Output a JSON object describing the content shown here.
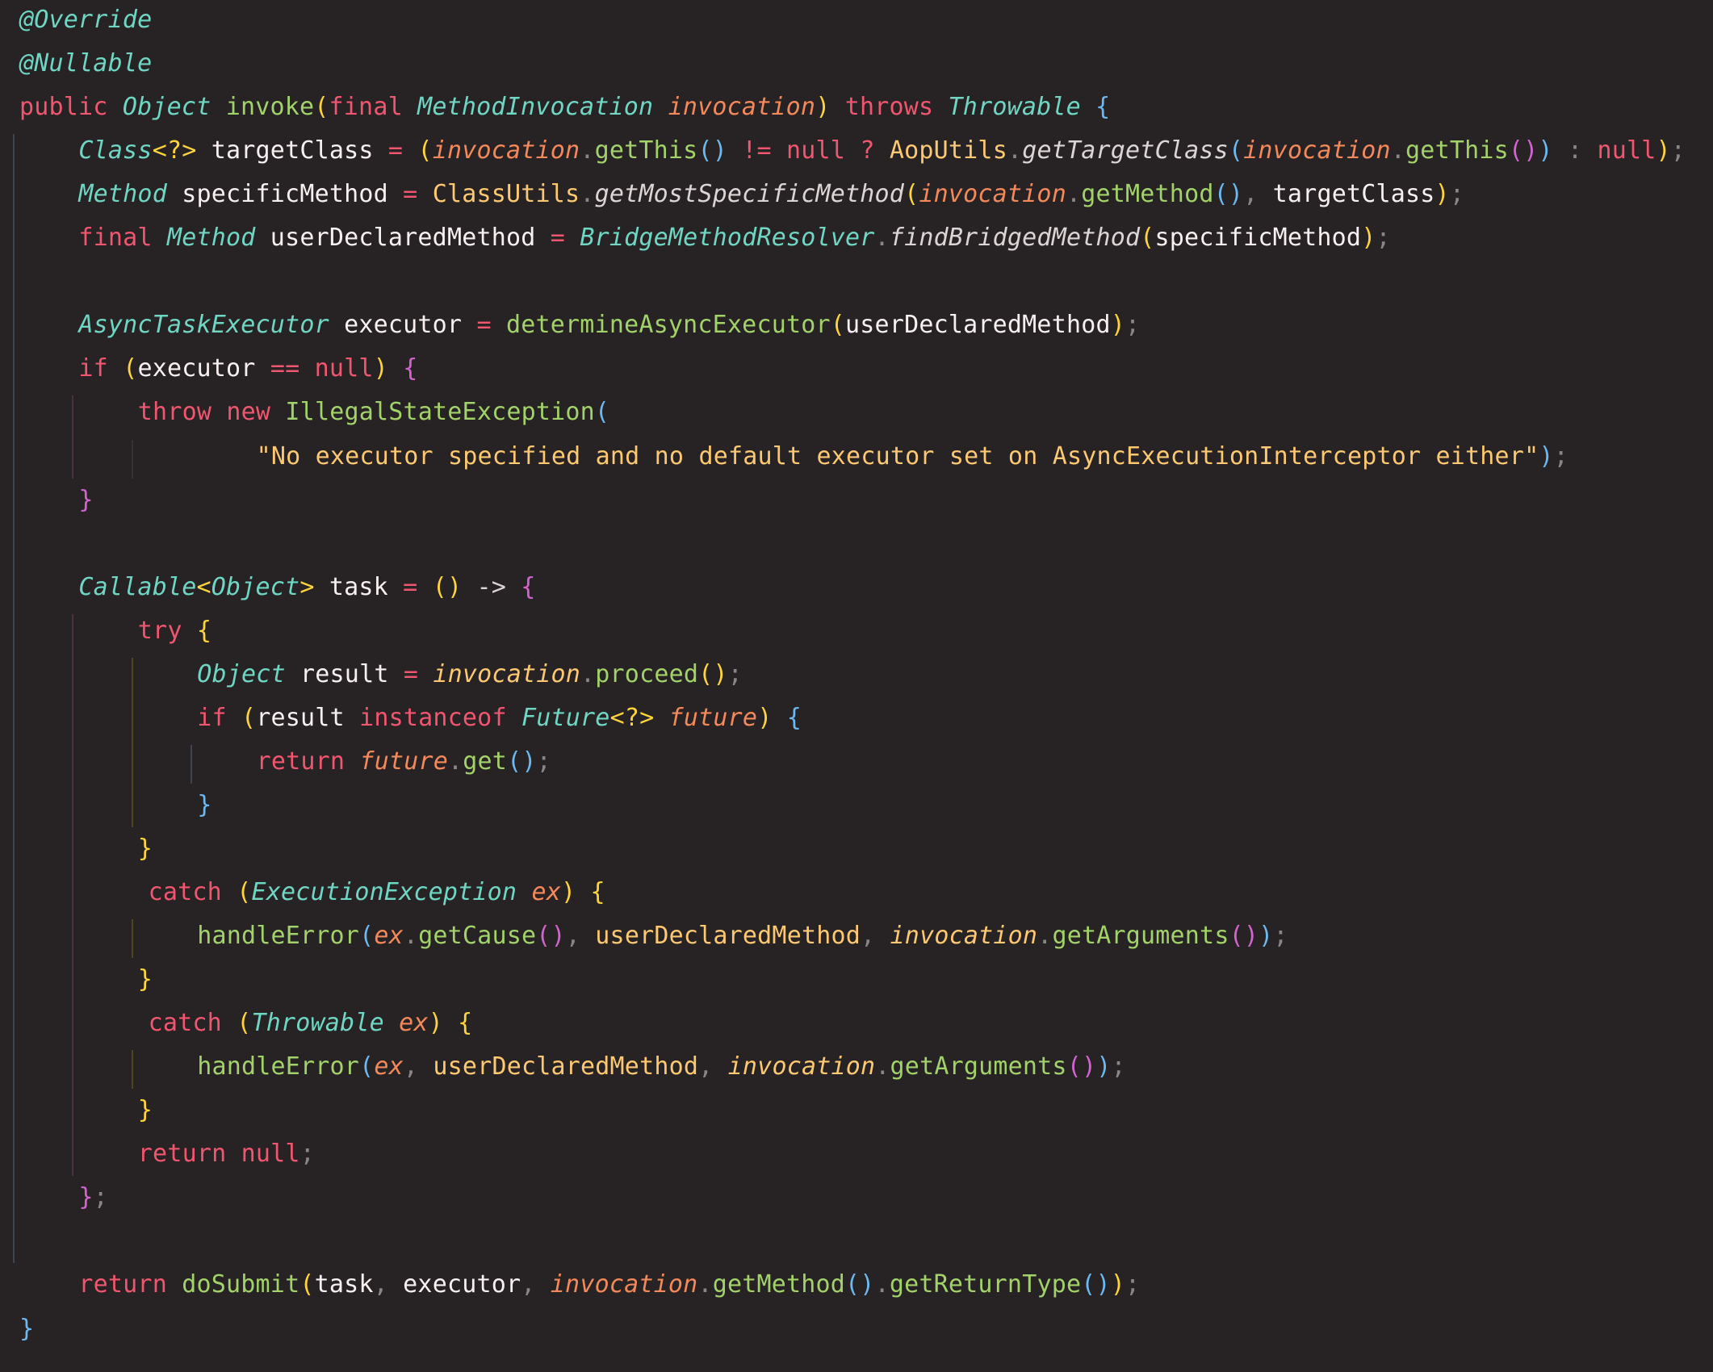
{
  "colors": {
    "background": "#272223",
    "keyword": "#f0566f",
    "type": "#6fd6c4",
    "function": "#a2d26a",
    "identifier": "#f8f0f0",
    "param": "#f3895b",
    "string": "#fcc872",
    "class_static": "#fcc872",
    "static_method": "#ddd5d5",
    "punct": "#8a8586",
    "brace_yellow": "#fdd43c",
    "brace_blue": "#6cb8f0",
    "brace_magenta": "#d264d0",
    "local_italic": "#fcc872"
  },
  "guides": [
    {
      "col": 0,
      "from_line": 3,
      "to_line": 28,
      "color": "#3e4450"
    },
    {
      "col": 1,
      "from_line": 9,
      "to_line": 10,
      "color": "#4a3040"
    },
    {
      "col": 2,
      "from_line": 10,
      "to_line": 10,
      "color": "#333"
    },
    {
      "col": 1,
      "from_line": 14,
      "to_line": 26,
      "color": "#4a3040"
    },
    {
      "col": 2,
      "from_line": 15,
      "to_line": 18,
      "color": "#504520"
    },
    {
      "col": 3,
      "from_line": 17,
      "to_line": 17,
      "color": "#3e4450"
    },
    {
      "col": 2,
      "from_line": 21,
      "to_line": 21,
      "color": "#504520"
    },
    {
      "col": 2,
      "from_line": 24,
      "to_line": 24,
      "color": "#504520"
    }
  ],
  "code": [
    {
      "indent": 0,
      "tokens": [
        [
          "@Override",
          "type",
          1
        ]
      ]
    },
    {
      "indent": 0,
      "tokens": [
        [
          "@Nullable",
          "type",
          1
        ]
      ]
    },
    {
      "indent": 0,
      "tokens": [
        [
          "public ",
          "keyword"
        ],
        [
          "Object",
          "type",
          1
        ],
        [
          " ",
          "identifier"
        ],
        [
          "invoke",
          "function"
        ],
        [
          "(",
          "brace_yellow"
        ],
        [
          "final ",
          "keyword"
        ],
        [
          "MethodInvocation",
          "type",
          1
        ],
        [
          " ",
          "identifier"
        ],
        [
          "invocation",
          "param",
          1
        ],
        [
          ")",
          "brace_yellow"
        ],
        [
          " throws ",
          "keyword"
        ],
        [
          "Throwable",
          "type",
          1
        ],
        [
          " ",
          "identifier"
        ],
        [
          "{",
          "brace_blue"
        ]
      ]
    },
    {
      "indent": 1,
      "tokens": [
        [
          "Class",
          "type",
          1
        ],
        [
          "<?>",
          "brace_yellow"
        ],
        [
          " targetClass ",
          "identifier"
        ],
        [
          "= ",
          "keyword"
        ],
        [
          "(",
          "brace_yellow"
        ],
        [
          "invocation",
          "param",
          1
        ],
        [
          ".",
          "punct"
        ],
        [
          "getThis",
          "function"
        ],
        [
          "()",
          "brace_blue"
        ],
        [
          " != null ? ",
          "keyword"
        ],
        [
          "AopUtils",
          "class_static"
        ],
        [
          ".",
          "punct"
        ],
        [
          "getTargetClass",
          "static_method",
          1
        ],
        [
          "(",
          "brace_blue"
        ],
        [
          "invocation",
          "param",
          1
        ],
        [
          ".",
          "punct"
        ],
        [
          "getThis",
          "function"
        ],
        [
          "()",
          "brace_magenta"
        ],
        [
          ")",
          "brace_blue"
        ],
        [
          " : ",
          "punct"
        ],
        [
          "null",
          "keyword"
        ],
        [
          ")",
          "brace_yellow"
        ],
        [
          ";",
          "punct"
        ]
      ]
    },
    {
      "indent": 1,
      "tokens": [
        [
          "Method",
          "type",
          1
        ],
        [
          " specificMethod ",
          "identifier"
        ],
        [
          "= ",
          "keyword"
        ],
        [
          "ClassUtils",
          "class_static"
        ],
        [
          ".",
          "punct"
        ],
        [
          "getMostSpecificMethod",
          "static_method",
          1
        ],
        [
          "(",
          "brace_yellow"
        ],
        [
          "invocation",
          "param",
          1
        ],
        [
          ".",
          "punct"
        ],
        [
          "getMethod",
          "function"
        ],
        [
          "()",
          "brace_blue"
        ],
        [
          ", ",
          "punct"
        ],
        [
          "targetClass",
          "identifier"
        ],
        [
          ")",
          "brace_yellow"
        ],
        [
          ";",
          "punct"
        ]
      ]
    },
    {
      "indent": 1,
      "tokens": [
        [
          "final ",
          "keyword"
        ],
        [
          "Method",
          "type",
          1
        ],
        [
          " userDeclaredMethod ",
          "identifier"
        ],
        [
          "= ",
          "keyword"
        ],
        [
          "BridgeMethodResolver",
          "type",
          1
        ],
        [
          ".",
          "punct"
        ],
        [
          "findBridgedMethod",
          "static_method",
          1
        ],
        [
          "(",
          "brace_yellow"
        ],
        [
          "specificMethod",
          "identifier"
        ],
        [
          ")",
          "brace_yellow"
        ],
        [
          ";",
          "punct"
        ]
      ]
    },
    {
      "indent": 0,
      "tokens": []
    },
    {
      "indent": 1,
      "tokens": [
        [
          "AsyncTaskExecutor",
          "type",
          1
        ],
        [
          " executor ",
          "identifier"
        ],
        [
          "= ",
          "keyword"
        ],
        [
          "determineAsyncExecutor",
          "function"
        ],
        [
          "(",
          "brace_yellow"
        ],
        [
          "userDeclaredMethod",
          "identifier"
        ],
        [
          ")",
          "brace_yellow"
        ],
        [
          ";",
          "punct"
        ]
      ]
    },
    {
      "indent": 1,
      "tokens": [
        [
          "if ",
          "keyword"
        ],
        [
          "(",
          "brace_yellow"
        ],
        [
          "executor ",
          "identifier"
        ],
        [
          "== null",
          "keyword"
        ],
        [
          ")",
          "brace_yellow"
        ],
        [
          " ",
          "identifier"
        ],
        [
          "{",
          "brace_magenta"
        ]
      ]
    },
    {
      "indent": 2,
      "tokens": [
        [
          "throw new ",
          "keyword"
        ],
        [
          "IllegalStateException",
          "function"
        ],
        [
          "(",
          "brace_blue"
        ]
      ]
    },
    {
      "indent": 4,
      "tokens": [
        [
          "\"No executor specified and no default executor set on AsyncExecutionInterceptor either\"",
          "string"
        ],
        [
          ")",
          "brace_blue"
        ],
        [
          ";",
          "punct"
        ]
      ]
    },
    {
      "indent": 1,
      "tokens": [
        [
          "}",
          "brace_magenta"
        ]
      ]
    },
    {
      "indent": 0,
      "tokens": []
    },
    {
      "indent": 1,
      "tokens": [
        [
          "Callable",
          "type",
          1
        ],
        [
          "<",
          "brace_yellow"
        ],
        [
          "Object",
          "type",
          1
        ],
        [
          ">",
          "brace_yellow"
        ],
        [
          " task ",
          "identifier"
        ],
        [
          "= ",
          "keyword"
        ],
        [
          "()",
          "brace_yellow"
        ],
        [
          " -> ",
          "static_method"
        ],
        [
          "{",
          "brace_magenta"
        ]
      ]
    },
    {
      "indent": 2,
      "tokens": [
        [
          "try ",
          "keyword"
        ],
        [
          "{",
          "brace_yellow"
        ]
      ]
    },
    {
      "indent": 3,
      "tokens": [
        [
          "Object",
          "type",
          1
        ],
        [
          " result ",
          "identifier"
        ],
        [
          "= ",
          "keyword"
        ],
        [
          "invocation",
          "local_italic",
          1
        ],
        [
          ".",
          "punct"
        ],
        [
          "proceed",
          "function"
        ],
        [
          "()",
          "brace_yellow"
        ],
        [
          ";",
          "punct"
        ]
      ]
    },
    {
      "indent": 3,
      "tokens": [
        [
          "if ",
          "keyword"
        ],
        [
          "(",
          "brace_yellow"
        ],
        [
          "result ",
          "identifier"
        ],
        [
          "instanceof ",
          "keyword"
        ],
        [
          "Future",
          "type",
          1
        ],
        [
          "<?>",
          "brace_yellow"
        ],
        [
          " ",
          "identifier"
        ],
        [
          "future",
          "param",
          1
        ],
        [
          ")",
          "brace_yellow"
        ],
        [
          " ",
          "identifier"
        ],
        [
          "{",
          "brace_blue"
        ]
      ]
    },
    {
      "indent": 4,
      "tokens": [
        [
          "return ",
          "keyword"
        ],
        [
          "future",
          "param",
          1
        ],
        [
          ".",
          "punct"
        ],
        [
          "get",
          "function"
        ],
        [
          "()",
          "brace_blue"
        ],
        [
          ";",
          "punct"
        ]
      ]
    },
    {
      "indent": 3,
      "tokens": [
        [
          "}",
          "brace_blue"
        ]
      ]
    },
    {
      "indent": 2,
      "tokens": [
        [
          "}",
          "brace_yellow"
        ]
      ]
    },
    {
      "indent": 2,
      "extra": 0.7,
      "tokens": [
        [
          "catch ",
          "keyword"
        ],
        [
          "(",
          "brace_yellow"
        ],
        [
          "ExecutionException",
          "type",
          1
        ],
        [
          " ",
          "identifier"
        ],
        [
          "ex",
          "param",
          1
        ],
        [
          ")",
          "brace_yellow"
        ],
        [
          " ",
          "identifier"
        ],
        [
          "{",
          "brace_yellow"
        ]
      ]
    },
    {
      "indent": 3,
      "tokens": [
        [
          "handleError",
          "function"
        ],
        [
          "(",
          "brace_blue"
        ],
        [
          "ex",
          "param",
          1
        ],
        [
          ".",
          "punct"
        ],
        [
          "getCause",
          "function"
        ],
        [
          "()",
          "brace_magenta"
        ],
        [
          ", ",
          "punct"
        ],
        [
          "userDeclaredMethod",
          "class_static"
        ],
        [
          ", ",
          "punct"
        ],
        [
          "invocation",
          "local_italic",
          1
        ],
        [
          ".",
          "punct"
        ],
        [
          "getArguments",
          "function"
        ],
        [
          "()",
          "brace_magenta"
        ],
        [
          ")",
          "brace_blue"
        ],
        [
          ";",
          "punct"
        ]
      ]
    },
    {
      "indent": 2,
      "tokens": [
        [
          "}",
          "brace_yellow"
        ]
      ]
    },
    {
      "indent": 2,
      "extra": 0.7,
      "tokens": [
        [
          "catch ",
          "keyword"
        ],
        [
          "(",
          "brace_yellow"
        ],
        [
          "Throwable",
          "type",
          1
        ],
        [
          " ",
          "identifier"
        ],
        [
          "ex",
          "param",
          1
        ],
        [
          ")",
          "brace_yellow"
        ],
        [
          " ",
          "identifier"
        ],
        [
          "{",
          "brace_yellow"
        ]
      ]
    },
    {
      "indent": 3,
      "tokens": [
        [
          "handleError",
          "function"
        ],
        [
          "(",
          "brace_blue"
        ],
        [
          "ex",
          "param",
          1
        ],
        [
          ", ",
          "punct"
        ],
        [
          "userDeclaredMethod",
          "class_static"
        ],
        [
          ", ",
          "punct"
        ],
        [
          "invocation",
          "local_italic",
          1
        ],
        [
          ".",
          "punct"
        ],
        [
          "getArguments",
          "function"
        ],
        [
          "()",
          "brace_magenta"
        ],
        [
          ")",
          "brace_blue"
        ],
        [
          ";",
          "punct"
        ]
      ]
    },
    {
      "indent": 2,
      "tokens": [
        [
          "}",
          "brace_yellow"
        ]
      ]
    },
    {
      "indent": 2,
      "tokens": [
        [
          "return null",
          "keyword"
        ],
        [
          ";",
          "punct"
        ]
      ]
    },
    {
      "indent": 1,
      "tokens": [
        [
          "}",
          "brace_magenta"
        ],
        [
          ";",
          "punct"
        ]
      ]
    },
    {
      "indent": 0,
      "tokens": []
    },
    {
      "indent": 1,
      "tokens": [
        [
          "return ",
          "keyword"
        ],
        [
          "doSubmit",
          "function"
        ],
        [
          "(",
          "brace_yellow"
        ],
        [
          "task",
          "identifier"
        ],
        [
          ", ",
          "punct"
        ],
        [
          "executor",
          "identifier"
        ],
        [
          ", ",
          "punct"
        ],
        [
          "invocation",
          "param",
          1
        ],
        [
          ".",
          "punct"
        ],
        [
          "getMethod",
          "function"
        ],
        [
          "()",
          "brace_blue"
        ],
        [
          ".",
          "punct"
        ],
        [
          "getReturnType",
          "function"
        ],
        [
          "()",
          "brace_blue"
        ],
        [
          ")",
          "brace_yellow"
        ],
        [
          ";",
          "punct"
        ]
      ]
    },
    {
      "indent": 0,
      "tokens": [
        [
          "}",
          "brace_blue"
        ]
      ]
    }
  ]
}
